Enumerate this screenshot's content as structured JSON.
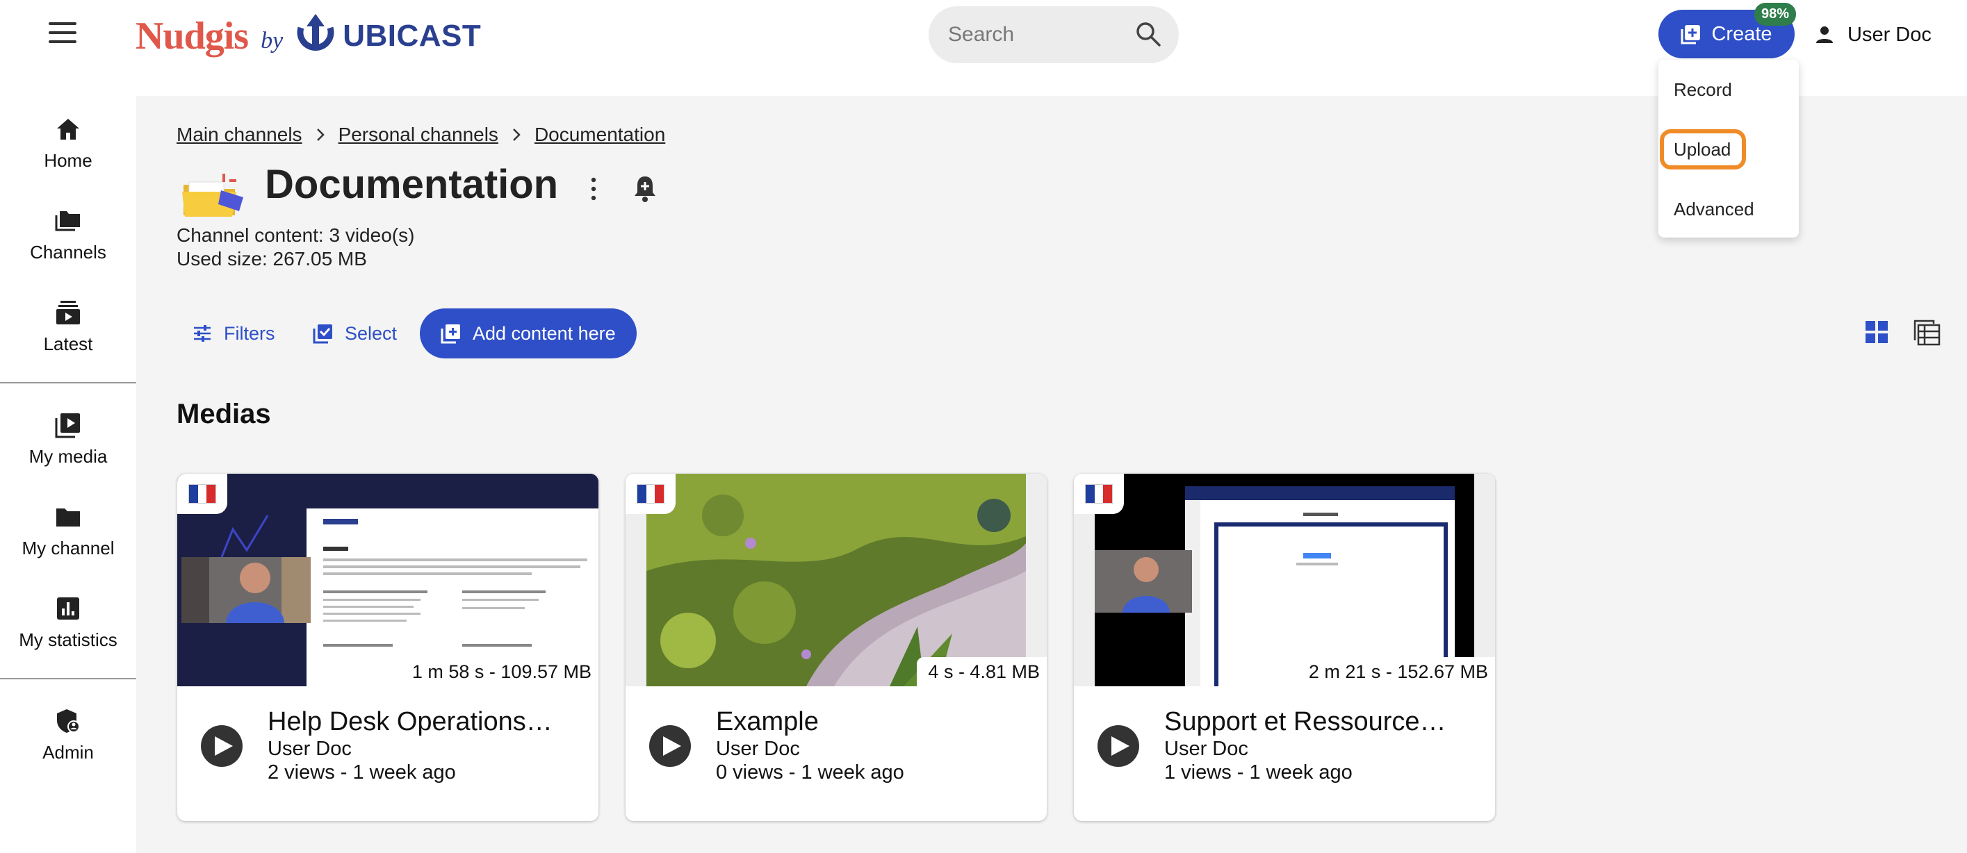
{
  "header": {
    "logo_brand": "Nudgis",
    "logo_by": "by",
    "logo_company": "UBICAST",
    "search_placeholder": "Search",
    "create_label": "Create",
    "create_badge": "98%",
    "user_name": "User Doc"
  },
  "create_menu": {
    "items": [
      "Record",
      "Upload",
      "Advanced"
    ],
    "highlighted": "Upload"
  },
  "sidebar": {
    "items": [
      {
        "label": "Home",
        "icon": "home-icon"
      },
      {
        "label": "Channels",
        "icon": "channels-icon"
      },
      {
        "label": "Latest",
        "icon": "latest-icon"
      },
      {
        "label": "My media",
        "icon": "my-media-icon"
      },
      {
        "label": "My channel",
        "icon": "folder-icon"
      },
      {
        "label": "My statistics",
        "icon": "statistics-icon"
      },
      {
        "label": "Admin",
        "icon": "admin-shield-icon"
      }
    ]
  },
  "breadcrumb": [
    "Main channels",
    "Personal channels",
    "Documentation"
  ],
  "channel": {
    "title": "Documentation",
    "content_line": "Channel content: 3 video(s)",
    "size_line": "Used size: 267.05 MB"
  },
  "toolbar": {
    "filters_label": "Filters",
    "select_label": "Select",
    "add_label": "Add content here"
  },
  "section_title": "Medias",
  "colors": {
    "accent": "#2e4fc7",
    "highlight_ring": "#f08c28",
    "badge": "#2e7d4a",
    "logo_red": "#e0584a",
    "logo_blue": "#2a3f8f"
  },
  "medias": [
    {
      "title": "Help Desk Operations…",
      "author": "User Doc",
      "stats": "2 views  - 1 week ago",
      "duration": "1 m 58 s - 109.57 MB",
      "language": "fr"
    },
    {
      "title": "Example",
      "author": "User Doc",
      "stats": "0 views  - 1 week ago",
      "duration": "4 s - 4.81 MB",
      "language": "fr"
    },
    {
      "title": "Support et Ressource…",
      "author": "User Doc",
      "stats": "1 views  - 1 week ago",
      "duration": "2 m 21 s - 152.67 MB",
      "language": "fr"
    }
  ]
}
